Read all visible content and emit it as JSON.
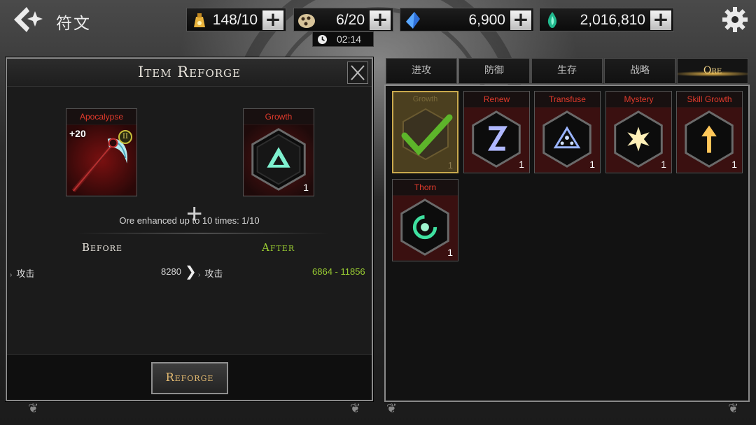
{
  "header": {
    "title": "符文",
    "resources": [
      {
        "name": "stamina",
        "value": "148/10",
        "icon": "lamp-icon",
        "color": "#e8b23c"
      },
      {
        "name": "tickets",
        "value": "6/20",
        "icon": "ticket-icon",
        "color": "#d8c49a"
      },
      {
        "name": "crystals",
        "value": "6,900",
        "icon": "crystal-icon",
        "color": "#5aa8ff"
      },
      {
        "name": "soul-gems",
        "value": "2,016,810",
        "icon": "soul-gem-icon",
        "color": "#3fe0b8"
      }
    ],
    "timer": "02:14"
  },
  "reforge_panel": {
    "title": "Item Reforge",
    "equipment": {
      "name": "Apocalypse",
      "enhance": "+20",
      "tier": "II"
    },
    "ore": {
      "name": "Growth",
      "qty": "1"
    },
    "enhance_note": "Ore enhanced up to 10 times: 1/10",
    "before_label": "Before",
    "after_label": "After",
    "stat": {
      "name": "攻击",
      "before": "8280",
      "after": "6864 - 11856"
    },
    "reforge_button": "Reforge"
  },
  "tabs": [
    {
      "label": "进攻",
      "active": false
    },
    {
      "label": "防御",
      "active": false
    },
    {
      "label": "生存",
      "active": false
    },
    {
      "label": "战略",
      "active": false
    },
    {
      "label": "Ore",
      "active": true
    }
  ],
  "ores": [
    {
      "name": "Growth",
      "qty": "1",
      "selected": true,
      "symbol": "tri",
      "color": "#5fd3b4"
    },
    {
      "name": "Renew",
      "qty": "1",
      "selected": false,
      "symbol": "Z",
      "color": "#9aa6ff"
    },
    {
      "name": "Transfuse",
      "qty": "1",
      "selected": false,
      "symbol": "dots",
      "color": "#9ab4ff"
    },
    {
      "name": "Mystery",
      "qty": "1",
      "selected": false,
      "symbol": "star",
      "color": "#ffe59a"
    },
    {
      "name": "Skill Growth",
      "qty": "1",
      "selected": false,
      "symbol": "arrow",
      "color": "#ffc85a"
    },
    {
      "name": "Thorn",
      "qty": "1",
      "selected": false,
      "symbol": "swirl",
      "color": "#3fe0a0"
    }
  ],
  "colors": {
    "red_label": "#e13a2c",
    "after_green": "#9acd32",
    "gold": "#e2b970"
  }
}
